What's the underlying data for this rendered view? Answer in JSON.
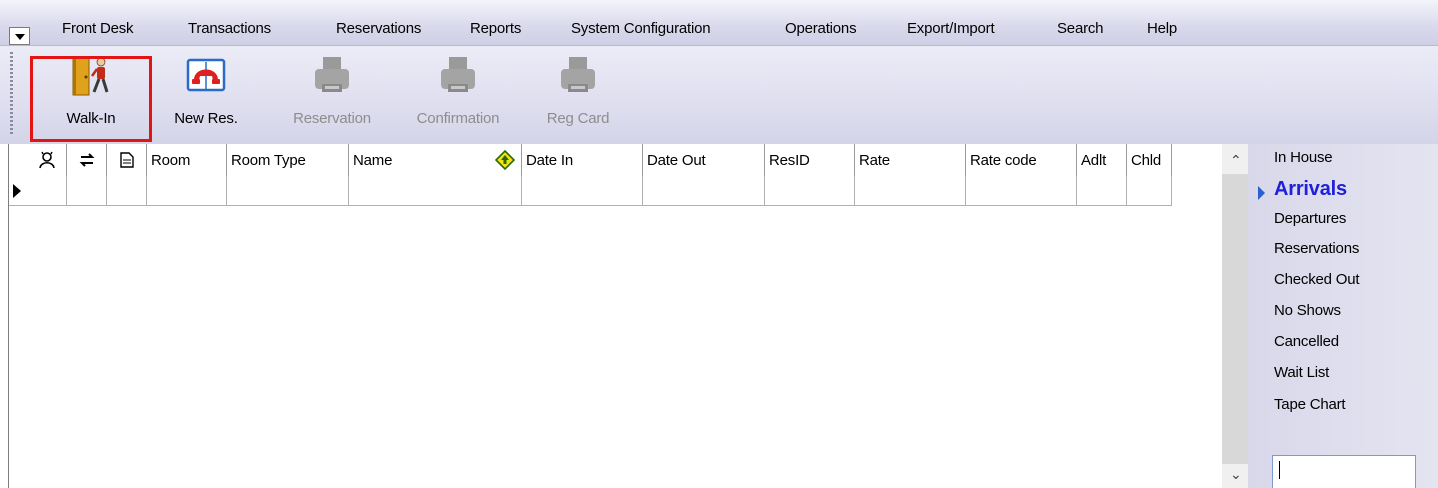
{
  "menu": {
    "items": [
      "Front Desk",
      "Transactions",
      "Reservations",
      "Reports",
      "System Configuration",
      "Operations",
      "Export/Import",
      "Search",
      "Help"
    ]
  },
  "toolbar": {
    "buttons": [
      {
        "label": "Walk-In",
        "icon": "walk-in-door-icon",
        "enabled": true,
        "highlighted": true
      },
      {
        "label": "New Res.",
        "icon": "telephone-book-icon",
        "enabled": true
      },
      {
        "label": "Reservation",
        "icon": "printer-icon",
        "enabled": false
      },
      {
        "label": "Confirmation",
        "icon": "printer-icon",
        "enabled": false
      },
      {
        "label": "Reg Card",
        "icon": "printer-icon",
        "enabled": false
      }
    ],
    "highlight_color": "#e31414"
  },
  "grid": {
    "columns": [
      {
        "label": "",
        "icon": "guest-profile-icon"
      },
      {
        "label": "",
        "icon": "transfer-arrows-icon"
      },
      {
        "label": "",
        "icon": "note-document-icon"
      },
      {
        "label": "Room"
      },
      {
        "label": "Room Type"
      },
      {
        "label": "Name",
        "sort_icon": "sort-up-diamond-icon"
      },
      {
        "label": "Date In"
      },
      {
        "label": "Date Out"
      },
      {
        "label": "ResID"
      },
      {
        "label": "Rate"
      },
      {
        "label": "Rate code"
      },
      {
        "label": "Adlt"
      },
      {
        "label": "Chld"
      }
    ],
    "rows": [
      [
        "",
        "",
        "",
        "",
        "",
        "",
        "",
        "",
        "",
        "",
        "",
        "",
        ""
      ]
    ]
  },
  "nav": {
    "items": [
      "In House",
      "Arrivals",
      "Departures",
      "Reservations",
      "Checked Out",
      "No Shows",
      "Cancelled",
      "Wait List",
      "Tape Chart"
    ],
    "active": "Arrivals",
    "active_color": "#2020d8"
  },
  "quick_search": {
    "value": ""
  }
}
